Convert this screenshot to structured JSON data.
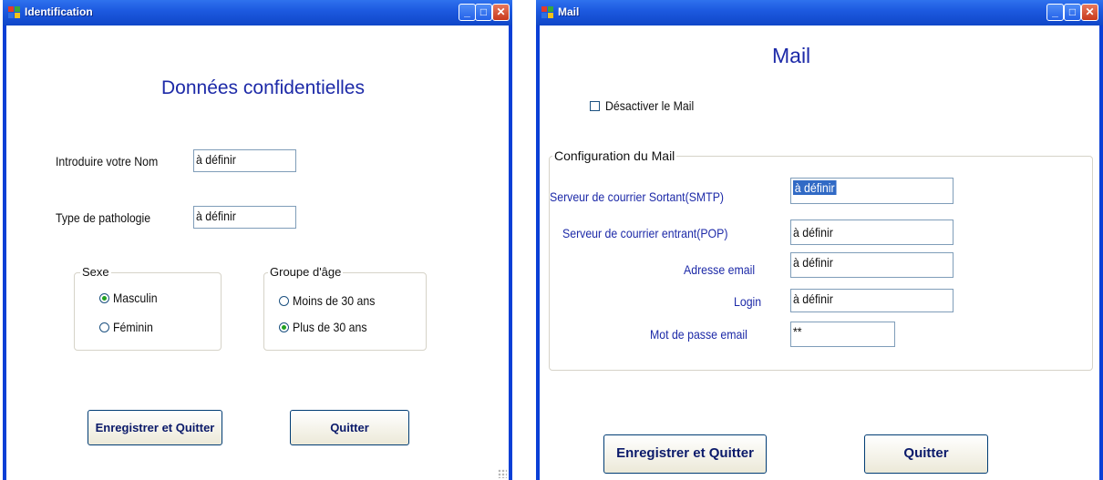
{
  "identification_window": {
    "title": "Identification",
    "heading": "Données confidentielles",
    "nom_label": "Introduire votre Nom",
    "nom_value": "à définir",
    "pathologie_label": "Type de pathologie",
    "pathologie_value": "à définir",
    "sexe": {
      "legend": "Sexe",
      "options": [
        "Masculin",
        "Féminin"
      ],
      "selected": "Masculin"
    },
    "age": {
      "legend": "Groupe d'âge",
      "options": [
        "Moins de 30 ans",
        "Plus de 30 ans"
      ],
      "selected": "Plus de 30 ans"
    },
    "save_button": "Enregistrer et Quitter",
    "quit_button": "Quitter"
  },
  "mail_window": {
    "title": "Mail",
    "heading": "Mail",
    "disable_checkbox": "Désactiver le Mail",
    "disable_checked": false,
    "group_legend": "Configuration du Mail",
    "smtp_label": "Serveur de courrier Sortant(SMTP)",
    "smtp_value": "à définir",
    "pop_label": "Serveur de courrier entrant(POP)",
    "pop_value": "à définir",
    "email_label": "Adresse email",
    "email_value": "à définir",
    "login_label": "Login",
    "login_value": "à définir",
    "password_label": "Mot de passe email",
    "password_value": "**",
    "save_button": "Enregistrer et Quitter",
    "quit_button": "Quitter"
  },
  "colors": {
    "title_bar": "#1d5ae0",
    "label_blue": "#1d2aa8",
    "selection": "#316ac5",
    "radio_dot": "#21a121"
  }
}
